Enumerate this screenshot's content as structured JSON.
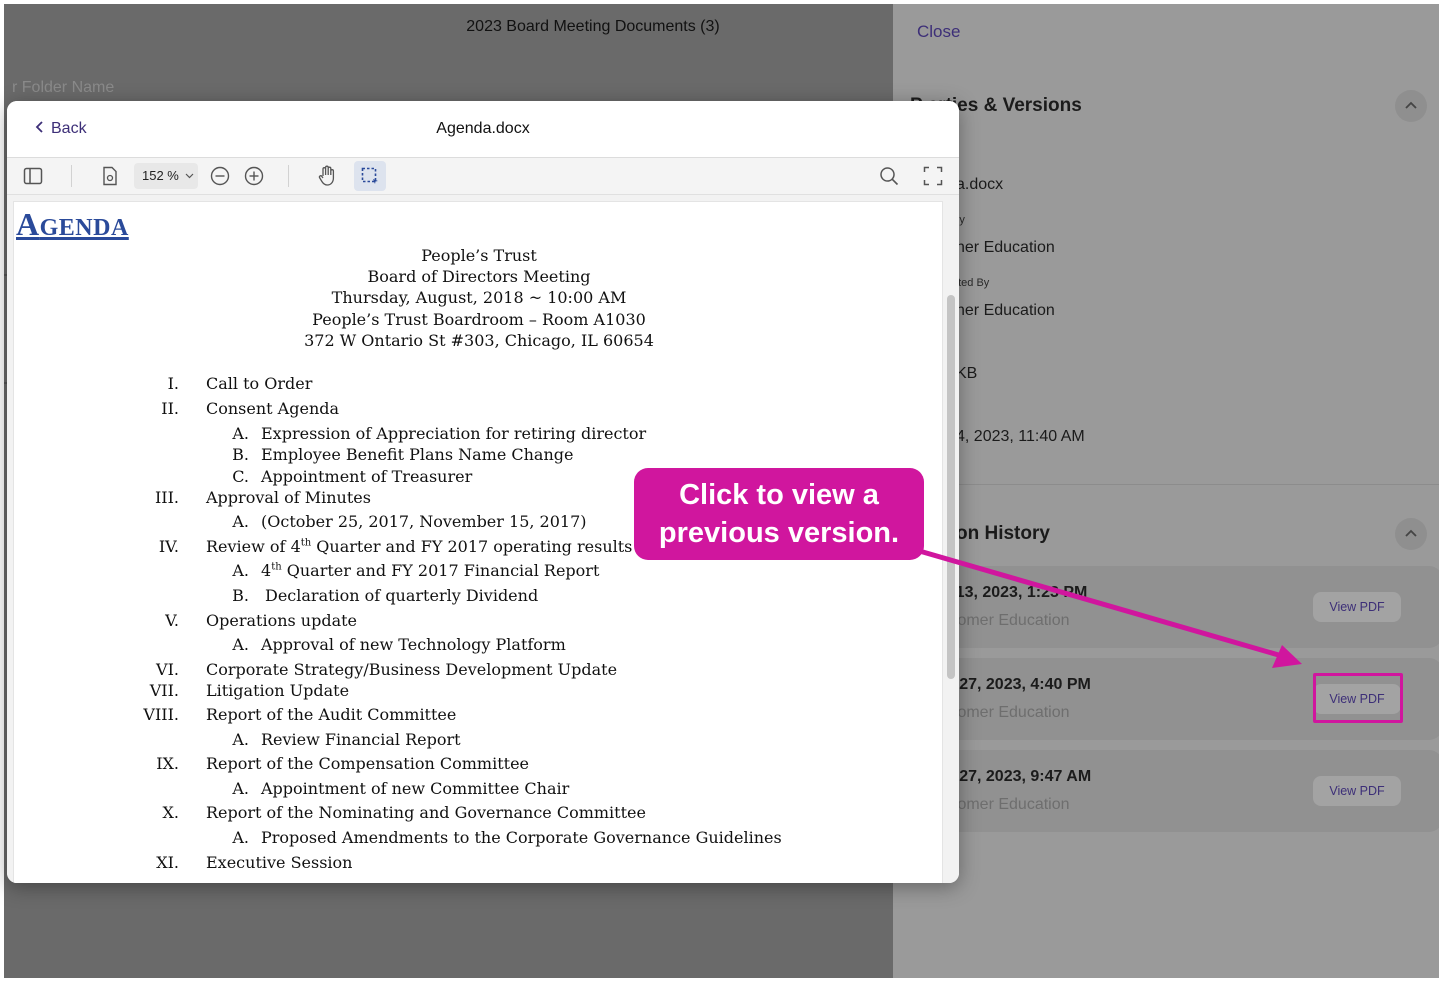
{
  "background": {
    "title": "2023 Board Meeting Documents (3)",
    "close_label": "Close",
    "folder_label": "r Folder Name"
  },
  "properties": {
    "heading": "P    erties & Versions",
    "name_value": "a.docx",
    "created_by_label": "By",
    "created_by_value": "ner Education",
    "updated_by_label": "ated By",
    "updated_by_value": "ner Education",
    "size_value": "KB",
    "date_value": "4, 2023, 11:40 AM"
  },
  "history": {
    "heading": "on History",
    "versions": [
      {
        "date": "r 13, 2023, 1:23 PM",
        "user": "stomer Education",
        "button": "View PDF"
      },
      {
        "date": "p 27, 2023, 4:40 PM",
        "user": "stomer Education",
        "button": "View PDF"
      },
      {
        "date": "p 27, 2023, 9:47 AM",
        "user": "stomer Education",
        "button": "View PDF"
      }
    ]
  },
  "viewer": {
    "back_label": "Back",
    "title": "Agenda.docx",
    "zoom": "152 %"
  },
  "document": {
    "agenda_first": "A",
    "agenda_rest": "GENDA",
    "header_lines": [
      "People’s Trust",
      "Board of Directors Meeting",
      "Thursday, August, 2018 ~ 10:00 AM",
      "People’s Trust Boardroom – Room A1030",
      "372 W Ontario St #303, Chicago, IL 60654"
    ],
    "items": [
      {
        "num": "I.",
        "text": "Call to Order"
      },
      {
        "num": "II.",
        "text": "Consent Agenda"
      },
      {
        "num": "A.",
        "text": "Expression of Appreciation for retiring director",
        "sub": true
      },
      {
        "num": "B.",
        "text": "Employee Benefit Plans Name Change",
        "sub": true
      },
      {
        "num": "C.",
        "text": "Appointment of Treasurer",
        "sub": true
      },
      {
        "num": "III.",
        "text": "Approval of Minutes"
      },
      {
        "num": "A.",
        "text": "(October 25, 2017, November 15, 2017)",
        "sub": true
      },
      {
        "num": "IV.",
        "text": "Review of 4th Quarter and FY 2017 operating results"
      },
      {
        "num": "A.",
        "text": "4th Quarter and FY 2017 Financial Report",
        "sub": true
      },
      {
        "num": "B.",
        "text": "Declaration of quarterly Dividend",
        "sub": true
      },
      {
        "num": "V.",
        "text": "Operations update"
      },
      {
        "num": "A.",
        "text": "Approval of new Technology Platform",
        "sub": true
      },
      {
        "num": "VI.",
        "text": "Corporate Strategy/Business Development Update"
      },
      {
        "num": "VII.",
        "text": "Litigation Update"
      },
      {
        "num": "VIII.",
        "text": "Report of the Audit Committee"
      },
      {
        "num": "A.",
        "text": "Review Financial Report",
        "sub": true
      },
      {
        "num": "IX.",
        "text": "Report of the Compensation Committee"
      },
      {
        "num": "A.",
        "text": "Appointment of new Committee Chair",
        "sub": true
      },
      {
        "num": "X.",
        "text": "Report of the Nominating and Governance Committee"
      },
      {
        "num": "A.",
        "text": "Proposed Amendments to the Corporate Governance Guidelines",
        "sub": true
      },
      {
        "num": "XI.",
        "text": "Executive Session"
      }
    ]
  },
  "callout": {
    "line1": "Click to view a",
    "line2": "previous version."
  },
  "colors": {
    "accent": "#3d2f78",
    "callout": "#d0169e",
    "agenda_title": "#2a4a9a"
  }
}
